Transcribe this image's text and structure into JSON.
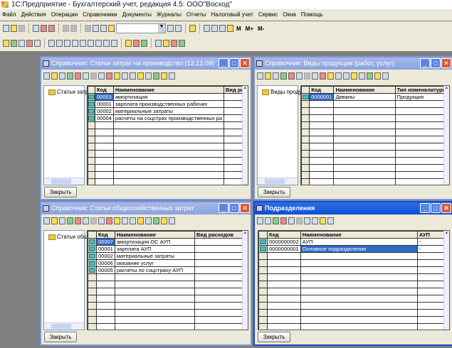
{
  "app_title": "1С:Предприятие - Бухгалтерский учет, редакция 4.5: ООО\"Восход\"",
  "menu": [
    "Файл",
    "Действия",
    "Операции",
    "Справочники",
    "Документы",
    "Журналы",
    "Отчеты",
    "Налоговый учет",
    "Сервис",
    "Окна",
    "Помощь"
  ],
  "toolbar": {
    "m": "M",
    "mplus": "M+",
    "mminus": "M-"
  },
  "windows": [
    {
      "title": "Справочник: Статьи затрат на производство (13.12.09)",
      "tree": "Статьи затрат",
      "columns": [
        "Код",
        "Наименование",
        "Вид расходов"
      ],
      "rows": [
        [
          "00003",
          "амортизация",
          ""
        ],
        [
          "00001",
          "зарплата производственных рабочих",
          ""
        ],
        [
          "00002",
          "материальные затраты",
          ""
        ],
        [
          "00004",
          "расчеты на соцстрах производственных ра",
          ""
        ]
      ],
      "close": "Закрыть"
    },
    {
      "title": "Справочник: Виды продукции (работ, услуг)",
      "tree": "Виды продукции (р",
      "columns": [
        "Код",
        "Наименование",
        "Тип номенклатуры"
      ],
      "rows": [
        [
          "0000001",
          "Диваны",
          "Продукция"
        ]
      ],
      "close": "Закрыть"
    },
    {
      "title": "Справочник: Статьи общехозяйственных затрат",
      "tree": "Статьи общехо",
      "columns": [
        "Код",
        "Наименование",
        "Вид расходов"
      ],
      "rows": [
        [
          "00007",
          "амортизация ОС АУП",
          ""
        ],
        [
          "00001",
          "зарплата АУП",
          ""
        ],
        [
          "00002",
          "материальные затраты",
          ""
        ],
        [
          "00006",
          "оказание услуг",
          ""
        ],
        [
          "00005",
          "расчеты по соцстраху АУП",
          ""
        ]
      ],
      "close": "Закрыть"
    },
    {
      "title": "Подразделения",
      "columns": [
        "Код",
        "Наименование",
        "АУП"
      ],
      "rows": [
        [
          "0000000002",
          "АУП",
          "-"
        ],
        [
          "0000000001",
          "Основное подразделение",
          "-"
        ]
      ],
      "close": "Закрыть"
    }
  ]
}
